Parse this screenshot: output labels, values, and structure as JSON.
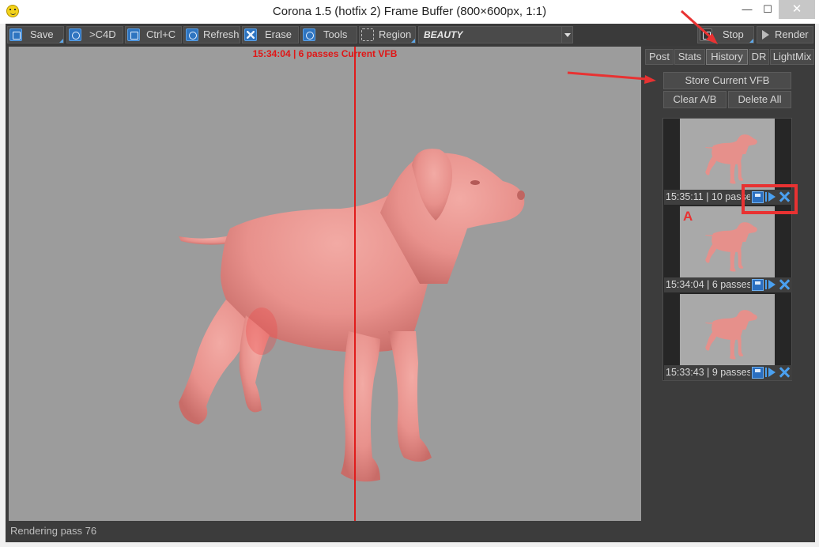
{
  "window": {
    "title": "Corona 1.5 (hotfix 2) Frame Buffer (800×600px, 1:1)",
    "min_label": "—",
    "max_label": "☐",
    "close_label": "✕"
  },
  "toolbar": {
    "save": "Save",
    "to_c4d": ">C4D",
    "copy": "Ctrl+C",
    "refresh": "Refresh",
    "erase": "Erase",
    "tools": "Tools",
    "region": "Region",
    "render_pass": "BEAUTY",
    "stop": "Stop",
    "render": "Render"
  },
  "viewport": {
    "info": "15:34:04  |  6 passes  Current VFB"
  },
  "status": {
    "text": "Rendering pass 76"
  },
  "tabs": [
    "Post",
    "Stats",
    "History",
    "DR",
    "LightMix"
  ],
  "active_tab": "History",
  "history_panel": {
    "store_label": "Store Current VFB",
    "clear_label": "Clear A/B",
    "delete_all_label": "Delete All",
    "items": [
      {
        "caption": "15:35:11 | 10 passes"
      },
      {
        "caption": "15:34:04 | 6 passes"
      },
      {
        "caption": "15:33:43 | 9 passes"
      }
    ]
  },
  "annotation": {
    "letter": "A",
    "color": "#e83232"
  },
  "colors": {
    "accent": "#2e74c0",
    "split_line": "#e11b1b",
    "viewport_bg": "#9c9c9c",
    "dog": "#e8918c"
  },
  "icons": {
    "save": "floppy-icon",
    "c4d": "c4d-icon",
    "copy": "clipboard-icon",
    "refresh": "refresh-icon",
    "erase": "erase-icon",
    "tools": "gear-icon",
    "region": "region-icon",
    "stop": "stop-icon",
    "render": "play-icon"
  }
}
